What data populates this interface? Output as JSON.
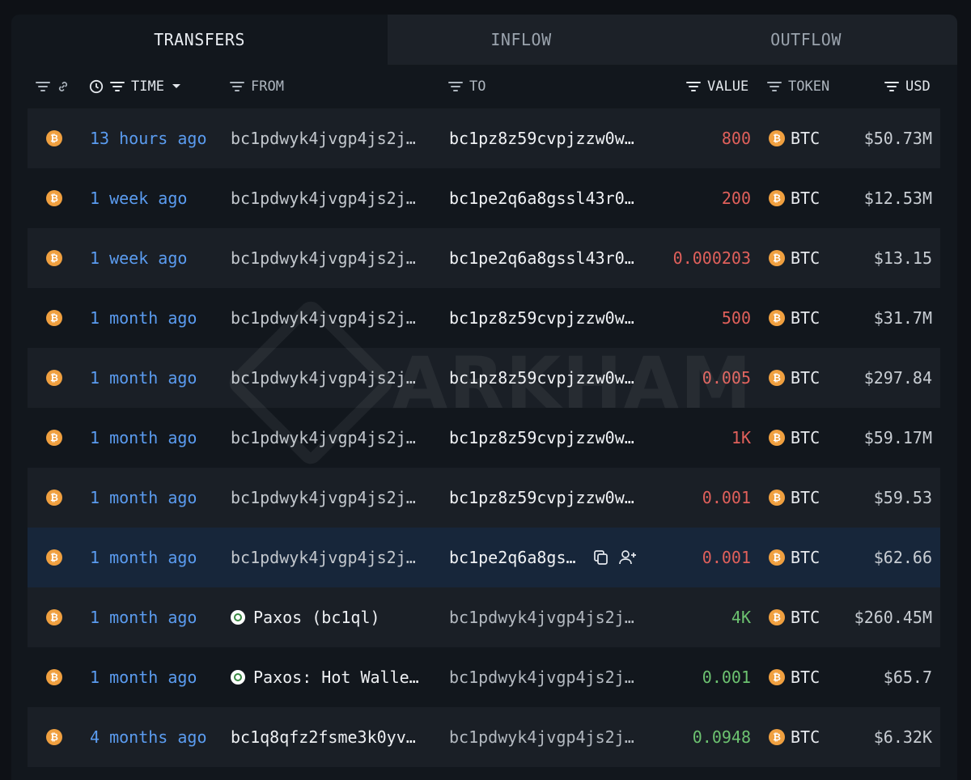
{
  "tabs": [
    {
      "label": "TRANSFERS",
      "active": true
    },
    {
      "label": "INFLOW",
      "active": false
    },
    {
      "label": "OUTFLOW",
      "active": false
    }
  ],
  "columns": {
    "time": "TIME",
    "from": "FROM",
    "to": "TO",
    "value": "VALUE",
    "token": "TOKEN",
    "usd": "USD"
  },
  "watermark": "ARKHAM",
  "colors": {
    "accent": "#5b9cf0",
    "outflow": "#e0605b",
    "inflow": "#6cc270",
    "btc": "#f0a040"
  },
  "rows": [
    {
      "time": "13 hours ago",
      "from": "bc1pdwyk4jvgp4js2j…",
      "to": "bc1pz8z59cvpjzzw0w…",
      "value": "800",
      "dir": "out",
      "token": "BTC",
      "usd": "$50.73M"
    },
    {
      "time": "1 week ago",
      "from": "bc1pdwyk4jvgp4js2j…",
      "to": "bc1pe2q6a8gssl43r0…",
      "value": "200",
      "dir": "out",
      "token": "BTC",
      "usd": "$12.53M"
    },
    {
      "time": "1 week ago",
      "from": "bc1pdwyk4jvgp4js2j…",
      "to": "bc1pe2q6a8gssl43r0…",
      "value": "0.000203",
      "dir": "out",
      "token": "BTC",
      "usd": "$13.15"
    },
    {
      "time": "1 month ago",
      "from": "bc1pdwyk4jvgp4js2j…",
      "to": "bc1pz8z59cvpjzzw0w…",
      "value": "500",
      "dir": "out",
      "token": "BTC",
      "usd": "$31.7M"
    },
    {
      "time": "1 month ago",
      "from": "bc1pdwyk4jvgp4js2j…",
      "to": "bc1pz8z59cvpjzzw0w…",
      "value": "0.005",
      "dir": "out",
      "token": "BTC",
      "usd": "$297.84"
    },
    {
      "time": "1 month ago",
      "from": "bc1pdwyk4jvgp4js2j…",
      "to": "bc1pz8z59cvpjzzw0w…",
      "value": "1K",
      "dir": "out",
      "token": "BTC",
      "usd": "$59.17M"
    },
    {
      "time": "1 month ago",
      "from": "bc1pdwyk4jvgp4js2j…",
      "to": "bc1pz8z59cvpjzzw0w…",
      "value": "0.001",
      "dir": "out",
      "token": "BTC",
      "usd": "$59.53"
    },
    {
      "time": "1 month ago",
      "from": "bc1pdwyk4jvgp4js2j…",
      "to": "bc1pe2q6a8gs…",
      "value": "0.001",
      "dir": "out",
      "token": "BTC",
      "usd": "$62.66",
      "hovered": true
    },
    {
      "time": "1 month ago",
      "from": "Paxos (bc1ql)",
      "from_entity": true,
      "to": "bc1pdwyk4jvgp4js2j…",
      "value": "4K",
      "dir": "in",
      "token": "BTC",
      "usd": "$260.45M"
    },
    {
      "time": "1 month ago",
      "from": "Paxos: Hot Walle…",
      "from_entity": true,
      "to": "bc1pdwyk4jvgp4js2j…",
      "value": "0.001",
      "dir": "in",
      "token": "BTC",
      "usd": "$65.7"
    },
    {
      "time": "4 months ago",
      "from": "bc1q8qfz2fsme3k0yv…",
      "from_bright": true,
      "to": "bc1pdwyk4jvgp4js2j…",
      "value": "0.0948",
      "dir": "in",
      "token": "BTC",
      "usd": "$6.32K"
    }
  ]
}
